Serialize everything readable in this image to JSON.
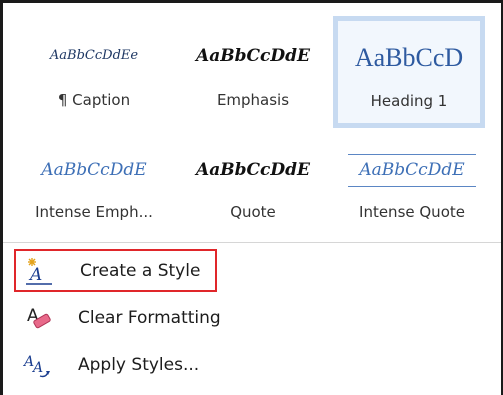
{
  "styles_gallery": {
    "row1": [
      {
        "preview": "AaBbCcDdEe",
        "label": "¶ Caption"
      },
      {
        "preview": "AaBbCcDdE",
        "label": "Emphasis"
      },
      {
        "preview": "AaBbCcD",
        "label": "Heading 1"
      }
    ],
    "row2": [
      {
        "preview": "AaBbCcDdE",
        "label": "Intense Emph..."
      },
      {
        "preview": "AaBbCcDdE",
        "label": "Quote"
      },
      {
        "preview": "AaBbCcDdE",
        "label": "Intense Quote"
      }
    ],
    "selected": "Heading 1"
  },
  "menu": {
    "create_style": {
      "label": "Create a Style",
      "icon": "create-style-icon"
    },
    "clear_formatting": {
      "label": "Clear Formatting",
      "icon": "eraser-icon"
    },
    "apply_styles": {
      "label": "Apply Styles...",
      "icon": "apply-styles-icon"
    }
  },
  "colors": {
    "highlight_border": "#e0262a",
    "selected_border": "#c7daf1",
    "heading_blue": "#2e5aa0"
  }
}
